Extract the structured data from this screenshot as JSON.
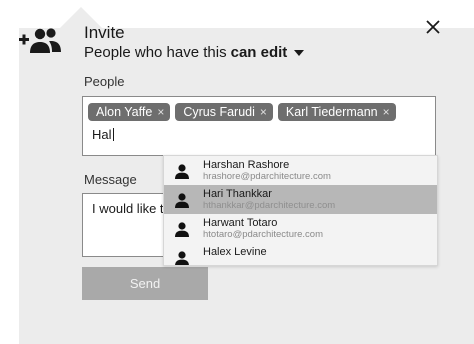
{
  "header": {
    "title": "Invite",
    "subtitle_prefix": "People who have this",
    "subtitle_permission": "can edit"
  },
  "people": {
    "label": "People",
    "chips": [
      {
        "name": "Alon Yaffe"
      },
      {
        "name": "Cyrus Farudi"
      },
      {
        "name": "Karl Tiedermann"
      }
    ],
    "typed_value": "Hal",
    "chip_remove_glyph": "×"
  },
  "message": {
    "label": "Message",
    "value": "I would like to"
  },
  "send_label": "Send",
  "suggestions": [
    {
      "name": "Harshan Rashore",
      "email": "hrashore@pdarchitecture.com",
      "active": false
    },
    {
      "name": "Hari Thankkar",
      "email": "hthankkar@pdarchitecture.com",
      "active": true
    },
    {
      "name": "Harwant Totaro",
      "email": "htotaro@pdarchitecture.com",
      "active": false
    },
    {
      "name": "Halex Levine",
      "email": "",
      "active": false
    }
  ],
  "colors": {
    "panel": "#ececec",
    "chip": "#6e6e6e",
    "active_row": "#b7b7b7",
    "send_button": "#a9a9a9"
  }
}
